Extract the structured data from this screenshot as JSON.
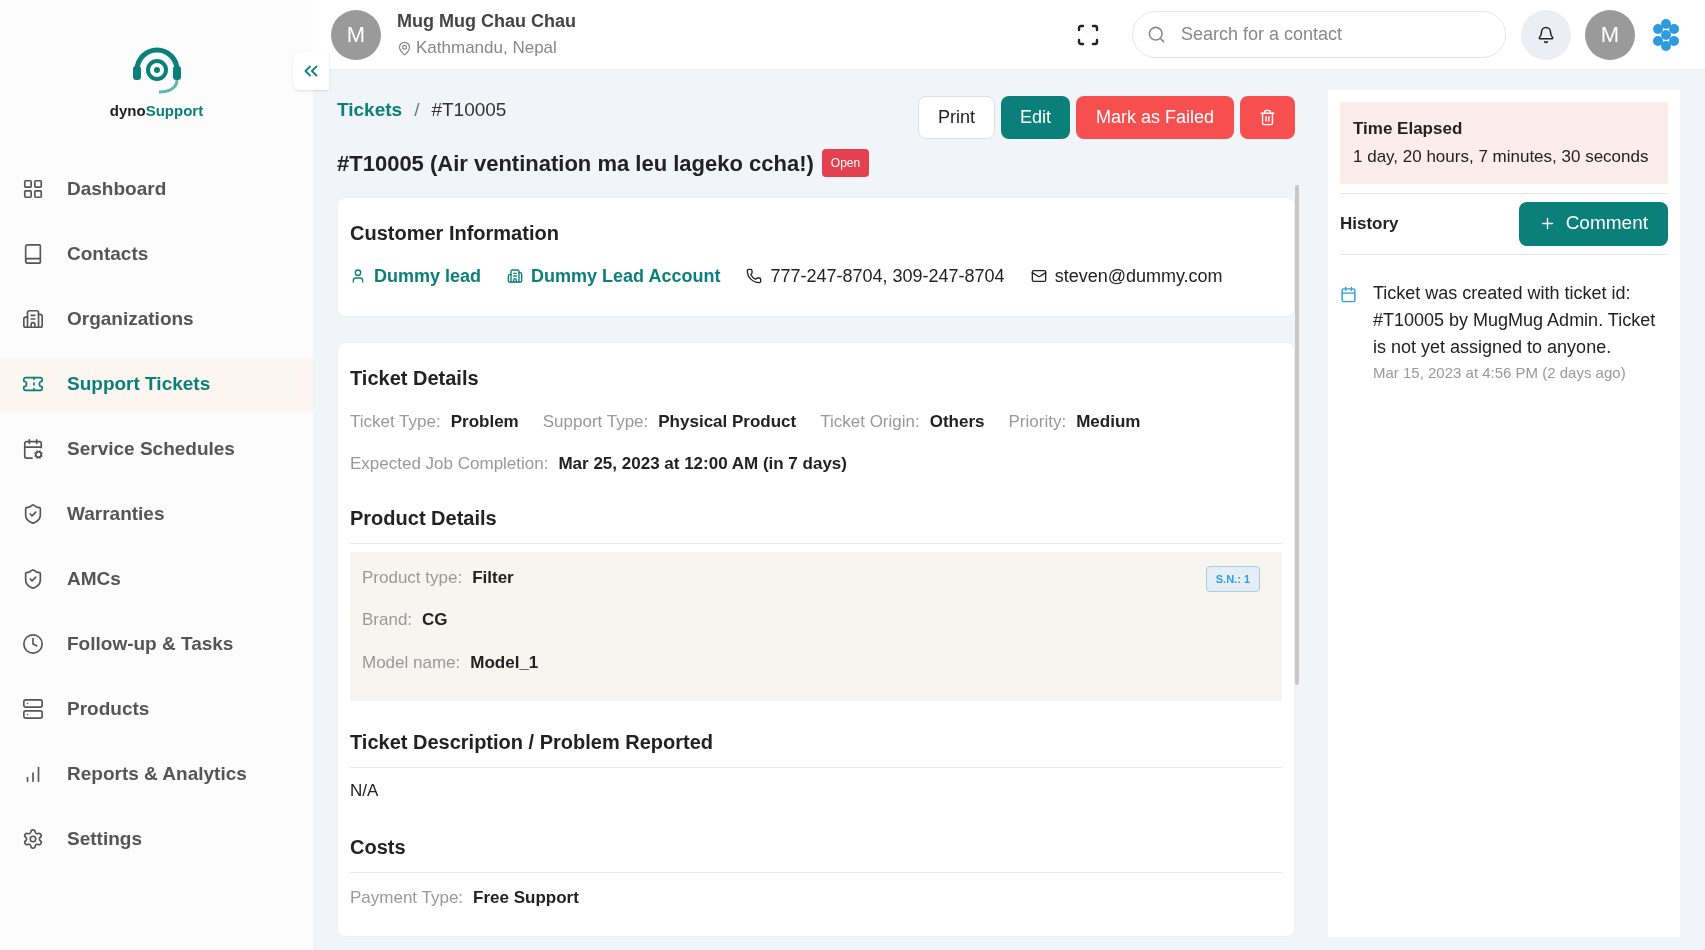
{
  "sidebar": {
    "logo": {
      "prefix": "dyno",
      "suffix": "Support"
    },
    "items": [
      {
        "label": "Dashboard",
        "selected": false
      },
      {
        "label": "Contacts",
        "selected": false
      },
      {
        "label": "Organizations",
        "selected": false
      },
      {
        "label": "Support Tickets",
        "selected": true
      },
      {
        "label": "Service Schedules",
        "selected": false
      },
      {
        "label": "Warranties",
        "selected": false
      },
      {
        "label": "AMCs",
        "selected": false
      },
      {
        "label": "Follow-up & Tasks",
        "selected": false
      },
      {
        "label": "Products",
        "selected": false
      },
      {
        "label": "Reports & Analytics",
        "selected": false
      },
      {
        "label": "Settings",
        "selected": false
      }
    ]
  },
  "header": {
    "user": {
      "initial": "M",
      "name": "Mug Mug Chau Chau",
      "location": "Kathmandu, Nepal"
    },
    "search": {
      "placeholder": "Search for a contact"
    },
    "avatar_initial": "M"
  },
  "breadcrumb": {
    "link": "Tickets",
    "separator": "/",
    "current": "#T10005"
  },
  "actions": [
    {
      "label": "Print",
      "kind": "outline"
    },
    {
      "label": "Edit",
      "kind": "primary"
    },
    {
      "label": "Mark as Failed",
      "kind": "danger"
    },
    {
      "kind": "delete"
    }
  ],
  "ticket": {
    "title": "#T10005 (Air ventination ma leu lageko ccha!)",
    "status": "Open"
  },
  "customer": {
    "heading": "Customer Information",
    "contact": "Dummy lead",
    "account": "Dummy Lead Account",
    "phones": "777-247-8704, 309-247-8704",
    "email": "steven@dummy.com"
  },
  "ticket_details": {
    "heading": "Ticket Details",
    "fields": [
      {
        "label": "Ticket Type:",
        "value": "Problem"
      },
      {
        "label": "Support Type:",
        "value": "Physical Product"
      },
      {
        "label": "Ticket Origin:",
        "value": "Others"
      },
      {
        "label": "Priority:",
        "value": "Medium"
      }
    ],
    "completion": {
      "label": "Expected Job Completion:",
      "value": "Mar 25, 2023 at 12:00 AM (in 7 days)"
    }
  },
  "product": {
    "heading": "Product Details",
    "serial": "S.N.: 1",
    "fields": [
      {
        "label": "Product type:",
        "value": "Filter"
      },
      {
        "label": "Brand:",
        "value": "CG"
      },
      {
        "label": "Model name:",
        "value": "Model_1"
      }
    ]
  },
  "description": {
    "heading": "Ticket Description / Problem Reported",
    "text": "N/A"
  },
  "costs": {
    "heading": "Costs",
    "fields": [
      {
        "label": "Payment Type:",
        "value": "Free Support"
      }
    ]
  },
  "time_elapsed": {
    "heading": "Time Elapsed",
    "value": "1 day, 20 hours, 7 minutes, 30 seconds"
  },
  "history": {
    "heading": "History",
    "button": "Comment",
    "entries": [
      {
        "text": "Ticket was created with ticket id: #T10005 by MugMug Admin. Ticket is not yet assigned to anyone.",
        "time": "Mar 15, 2023 at 4:56 PM (2 days ago)"
      }
    ]
  }
}
